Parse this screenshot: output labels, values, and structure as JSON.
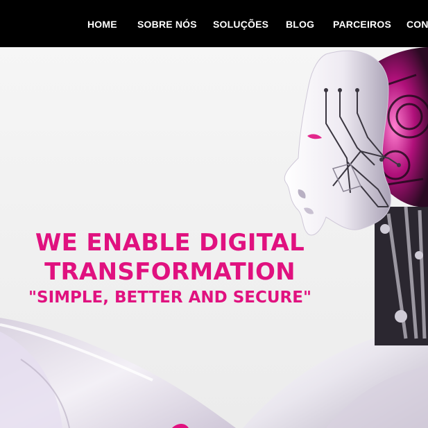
{
  "nav": {
    "items": [
      {
        "label": "HOME"
      },
      {
        "label": "SOBRE NÓS"
      },
      {
        "label": "SOLUÇÕES"
      },
      {
        "label": "BLOG"
      },
      {
        "label": "PARCEIROS"
      },
      {
        "label": "CON"
      }
    ]
  },
  "hero": {
    "line1": "WE ENABLE DIGITAL",
    "line2": "TRANSFORMATION",
    "tagline": "\"SIMPLE, BETTER AND SECURE\""
  },
  "colors": {
    "nav_background": "#000000",
    "nav_text": "#ffffff",
    "accent": "#e0117f",
    "background": "#f2f2f2"
  },
  "images": {
    "hero_image": "humanoid-robot-illustration"
  }
}
